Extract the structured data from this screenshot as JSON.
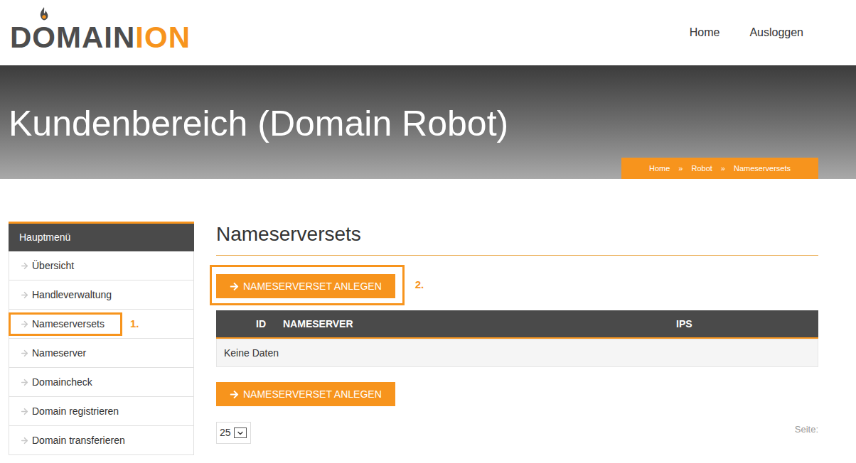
{
  "header": {
    "logo": {
      "parts": [
        {
          "text": "D",
          "accent": false,
          "flame": false
        },
        {
          "text": "O",
          "accent": false,
          "flame": true
        },
        {
          "text": "MAIN",
          "accent": false,
          "flame": false
        },
        {
          "text": "ION",
          "accent": true,
          "flame": false
        }
      ]
    },
    "nav": [
      "Home",
      "Ausloggen"
    ]
  },
  "banner": {
    "title": "Kundenbereich (Domain Robot)",
    "breadcrumb": {
      "items": [
        "Home",
        "Robot",
        "Nameserversets"
      ],
      "separator": "»"
    }
  },
  "sidebar": {
    "title": "Hauptmenü",
    "highlight_annotation": "1.",
    "items": [
      {
        "label": "Übersicht",
        "highlighted": false
      },
      {
        "label": "Handleverwaltung",
        "highlighted": false
      },
      {
        "label": "Nameserversets",
        "highlighted": true
      },
      {
        "label": "Nameserver",
        "highlighted": false
      },
      {
        "label": "Domaincheck",
        "highlighted": false
      },
      {
        "label": "Domain registrieren",
        "highlighted": false
      },
      {
        "label": "Domain transferieren",
        "highlighted": false
      }
    ]
  },
  "main": {
    "heading": "Nameserversets",
    "create_button": {
      "label": "NAMESERVERSET ANLEGEN"
    },
    "top_button_highlighted": true,
    "top_button_annotation": "2.",
    "table": {
      "columns": [
        "ID",
        "NAMESERVER",
        "IPS"
      ],
      "rows": [],
      "empty_text": "Keine Daten"
    },
    "pager": {
      "page_size": "25",
      "page_label": "Seite:"
    }
  }
}
